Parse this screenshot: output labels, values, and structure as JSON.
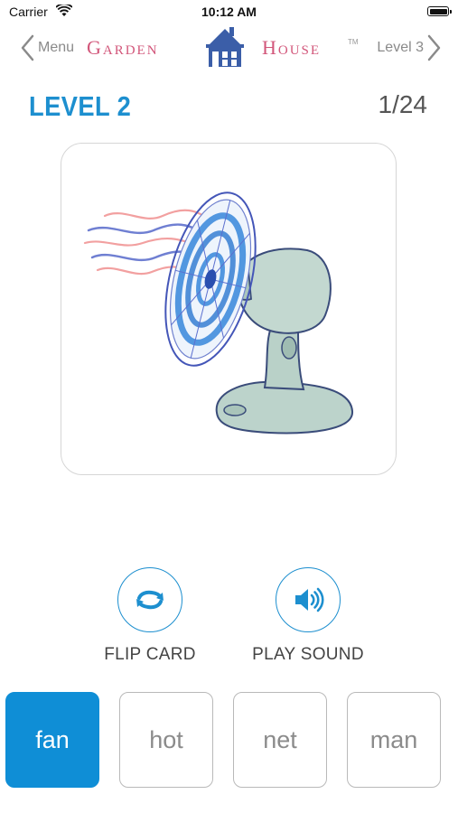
{
  "status_bar": {
    "carrier": "Carrier",
    "time": "10:12 AM",
    "wifi_icon": "wifi-icon",
    "battery_icon": "battery-icon"
  },
  "nav": {
    "back_label": "Menu",
    "back_icon": "chevron-left-icon",
    "brand_left": "Garden",
    "brand_right": "House",
    "brand_tm": "TM",
    "logo_icon": "house-logo-icon",
    "next_label": "Level 3",
    "next_icon": "chevron-right-icon",
    "brand_color": "#d2567a",
    "logo_color": "#3b5ea8"
  },
  "header": {
    "level_title": "LEVEL 2",
    "counter": "1/24",
    "accent_color": "#1d8fcf"
  },
  "card": {
    "image_icon": "electric-fan-illustration"
  },
  "controls": {
    "flip": {
      "label": "FLIP CARD",
      "icon": "flip-arrows-icon"
    },
    "sound": {
      "label": "PLAY SOUND",
      "icon": "speaker-icon"
    }
  },
  "choices": [
    {
      "label": "fan",
      "selected": true
    },
    {
      "label": "hot",
      "selected": false
    },
    {
      "label": "net",
      "selected": false
    },
    {
      "label": "man",
      "selected": false
    }
  ],
  "colors": {
    "selected_choice": "#0f8ed6",
    "choice_border": "#b9b9b9",
    "choice_text": "#8b8b8b"
  }
}
